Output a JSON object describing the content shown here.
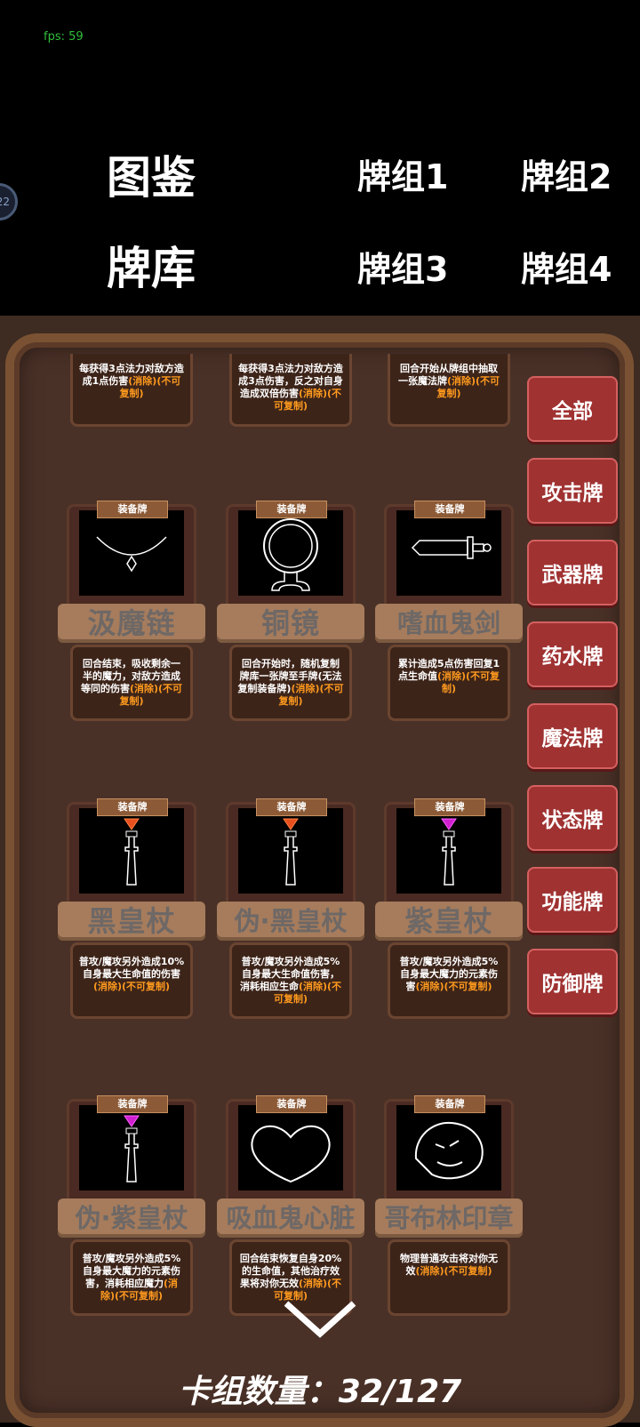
{
  "fps": "fps: 59",
  "side_badge": "22",
  "nav": {
    "tujian": "图鉴",
    "paiku": "牌库",
    "deck1": "牌组1",
    "deck2": "牌组2",
    "deck3": "牌组3",
    "deck4": "牌组4"
  },
  "top_row": [
    {
      "desc": "每获得3点法力对敌方造成1点伤害",
      "tag": "(消除)",
      "tail": "(不可复制)"
    },
    {
      "desc": "每获得3点法力对敌方造成3点伤害，反之对自身造成双倍伤害",
      "tag": "(消除)",
      "tail": "(不可复制)"
    },
    {
      "desc": "回合开始从牌组中抽取一张魔法牌",
      "tag": "(消除)",
      "tail": "(不可复制)"
    }
  ],
  "cards": [
    {
      "type": "装备牌",
      "name": "汲魔链",
      "desc": "回合结束，吸收剩余一半的魔力，对敌方造成等同的伤害",
      "tag": "(消除)",
      "tail": "(不可复制)"
    },
    {
      "type": "装备牌",
      "name": "铜镜",
      "desc": "回合开始时，随机复制牌库一张牌至手牌(无法复制装备牌)",
      "tag": "(消除)",
      "tail": "(不可复制)"
    },
    {
      "type": "装备牌",
      "name": "嗜血鬼剑",
      "desc": "累计造成5点伤害回复1点生命值",
      "tag": "(消除)",
      "tail": "(不可复制)"
    },
    {
      "type": "装备牌",
      "name": "黑皇杖",
      "desc": "普攻/魔攻另外造成10%自身最大生命值的伤害",
      "tag": "(消除)",
      "tail": "(不可复制)"
    },
    {
      "type": "装备牌",
      "name": "伪·黑皇杖",
      "desc": "普攻/魔攻另外造成5%自身最大生命值伤害，消耗相应生命",
      "tag": "(消除)",
      "tail": "(不可复制)"
    },
    {
      "type": "装备牌",
      "name": "紫皇杖",
      "desc": "普攻/魔攻另外造成5%自身最大魔力的元素伤害",
      "tag": "(消除)",
      "tail": "(不可复制)"
    },
    {
      "type": "装备牌",
      "name": "伪·紫皇杖",
      "desc": "普攻/魔攻另外造成5%自身最大魔力的元素伤害，消耗相应魔力",
      "tag": "(消除)",
      "tail": "(不可复制)"
    },
    {
      "type": "装备牌",
      "name": "吸血鬼心脏",
      "desc": "回合结束恢复自身20%的生命值，其他治疗效果将对你无效",
      "tag": "(消除)",
      "tail": "(不可复制)"
    },
    {
      "type": "装备牌",
      "name": "哥布林印章",
      "desc": "物理普通攻击将对你无效",
      "tag": "(消除)",
      "tail": "(不可复制)"
    }
  ],
  "filters": [
    "全部",
    "攻击牌",
    "武器牌",
    "药水牌",
    "魔法牌",
    "状态牌",
    "功能牌",
    "防御牌"
  ],
  "count_label": "卡组数量：32/127",
  "colors": {
    "filter_bg": "#a03232",
    "highlight": "#ff9a1e",
    "fps": "#2fbf3a"
  },
  "icons": [
    "necklace-icon",
    "mirror-icon",
    "sword-icon",
    "orange-gem-staff-icon",
    "orange-gem-staff-icon",
    "purple-gem-staff-icon",
    "purple-gem-staff-icon",
    "heart-icon",
    "goblin-head-icon",
    "chevron-down-icon"
  ]
}
